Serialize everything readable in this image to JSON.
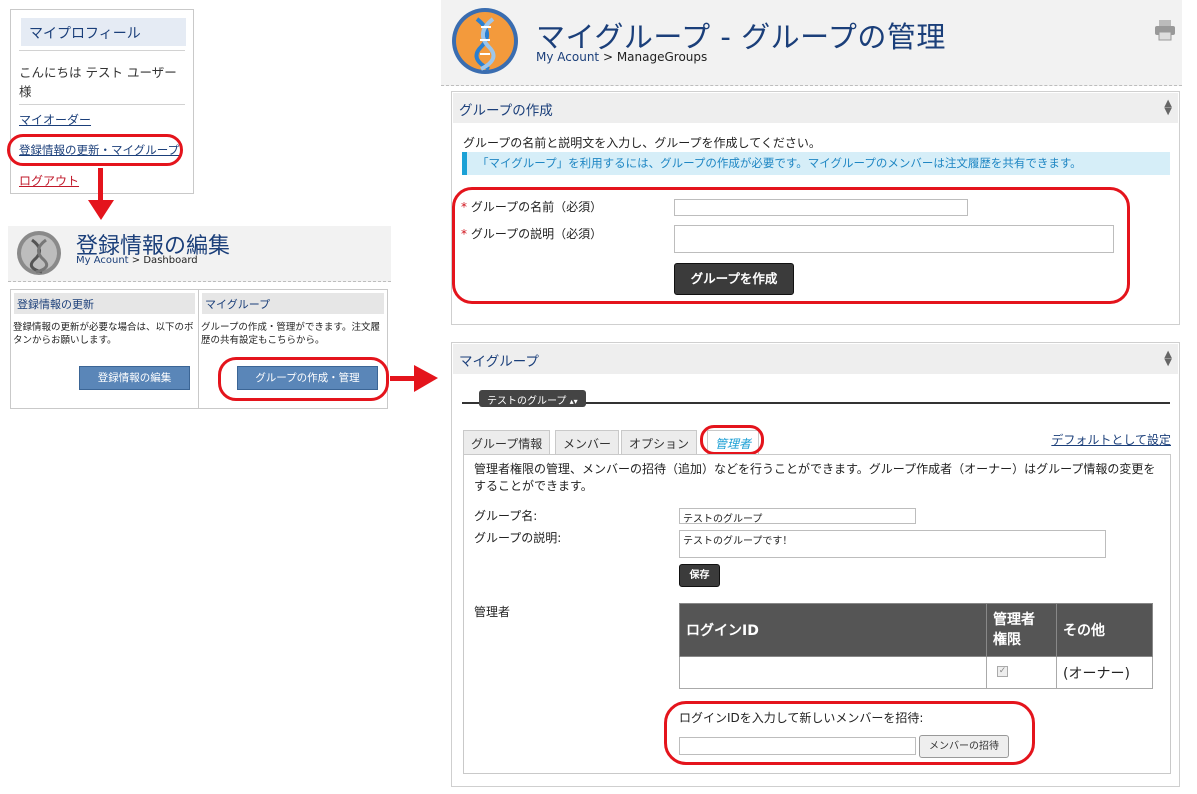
{
  "profile": {
    "title": "マイプロフィール",
    "greeting": "こんにちは テスト ユーザー様",
    "links": [
      "マイオーダー",
      "登録情報の更新・マイグループ",
      "ログアウト"
    ]
  },
  "dashboard": {
    "title": "登録情報の編集",
    "breadcrumb_link": "My Acount",
    "breadcrumb_sep": " > ",
    "breadcrumb_current": "Dashboard",
    "col1": {
      "heading": "登録情報の更新",
      "text": "登録情報の更新が必要な場合は、以下のボタンからお願いします。",
      "button": "登録情報の編集"
    },
    "col2": {
      "heading": "マイグループ",
      "text": "グループの作成・管理ができます。注文履歴の共有設定もこちらから。",
      "button": "グループの作成・管理"
    }
  },
  "header": {
    "title": "マイグループ - グループの管理",
    "breadcrumb_link": "My Acount",
    "breadcrumb_sep": " > ",
    "breadcrumb_current": "ManageGroups",
    "print_icon": "printer-icon"
  },
  "create": {
    "heading": "グループの作成",
    "intro": "グループの名前と説明文を入力し、グループを作成してください。",
    "notice": "「マイグループ」を利用するには、グループの作成が必要です。マイグループのメンバーは注文履歴を共有できます。",
    "name_label": "グループの名前（必須）",
    "desc_label": "グループの説明（必須）",
    "required_mark": "*",
    "name_value": "",
    "desc_value": "",
    "submit": "グループを作成"
  },
  "mygroup": {
    "heading": "マイグループ",
    "group_select": "テストのグループ",
    "tabs": [
      "グループ情報",
      "メンバー",
      "オプション",
      "管理者"
    ],
    "active_tab": 3,
    "default_link": "デフォルトとして設定",
    "description": "管理者権限の管理、メンバーの招待（追加）などを行うことができます。グループ作成者（オーナー）はグループ情報の変更をすることができます。",
    "group_name_label": "グループ名:",
    "group_name_value": "テストのグループ",
    "group_desc_label": "グループの説明:",
    "group_desc_value": "テストのグループです！",
    "save": "保存",
    "admins_label": "管理者",
    "table": {
      "headers": [
        "ログインID",
        "管理者\n権限",
        "その他"
      ],
      "rows": [
        [
          "",
          "✓",
          "(オーナー)"
        ]
      ]
    },
    "invite_label": "ログインIDを入力して新しいメンバーを招待:",
    "invite_value": "",
    "invite_button": "メンバーの招待"
  },
  "colors": {
    "accent": "#1b3f7a",
    "highlight": "#e4141c",
    "notice_bg": "#d6eef8",
    "notice_border": "#1ba1d6"
  }
}
